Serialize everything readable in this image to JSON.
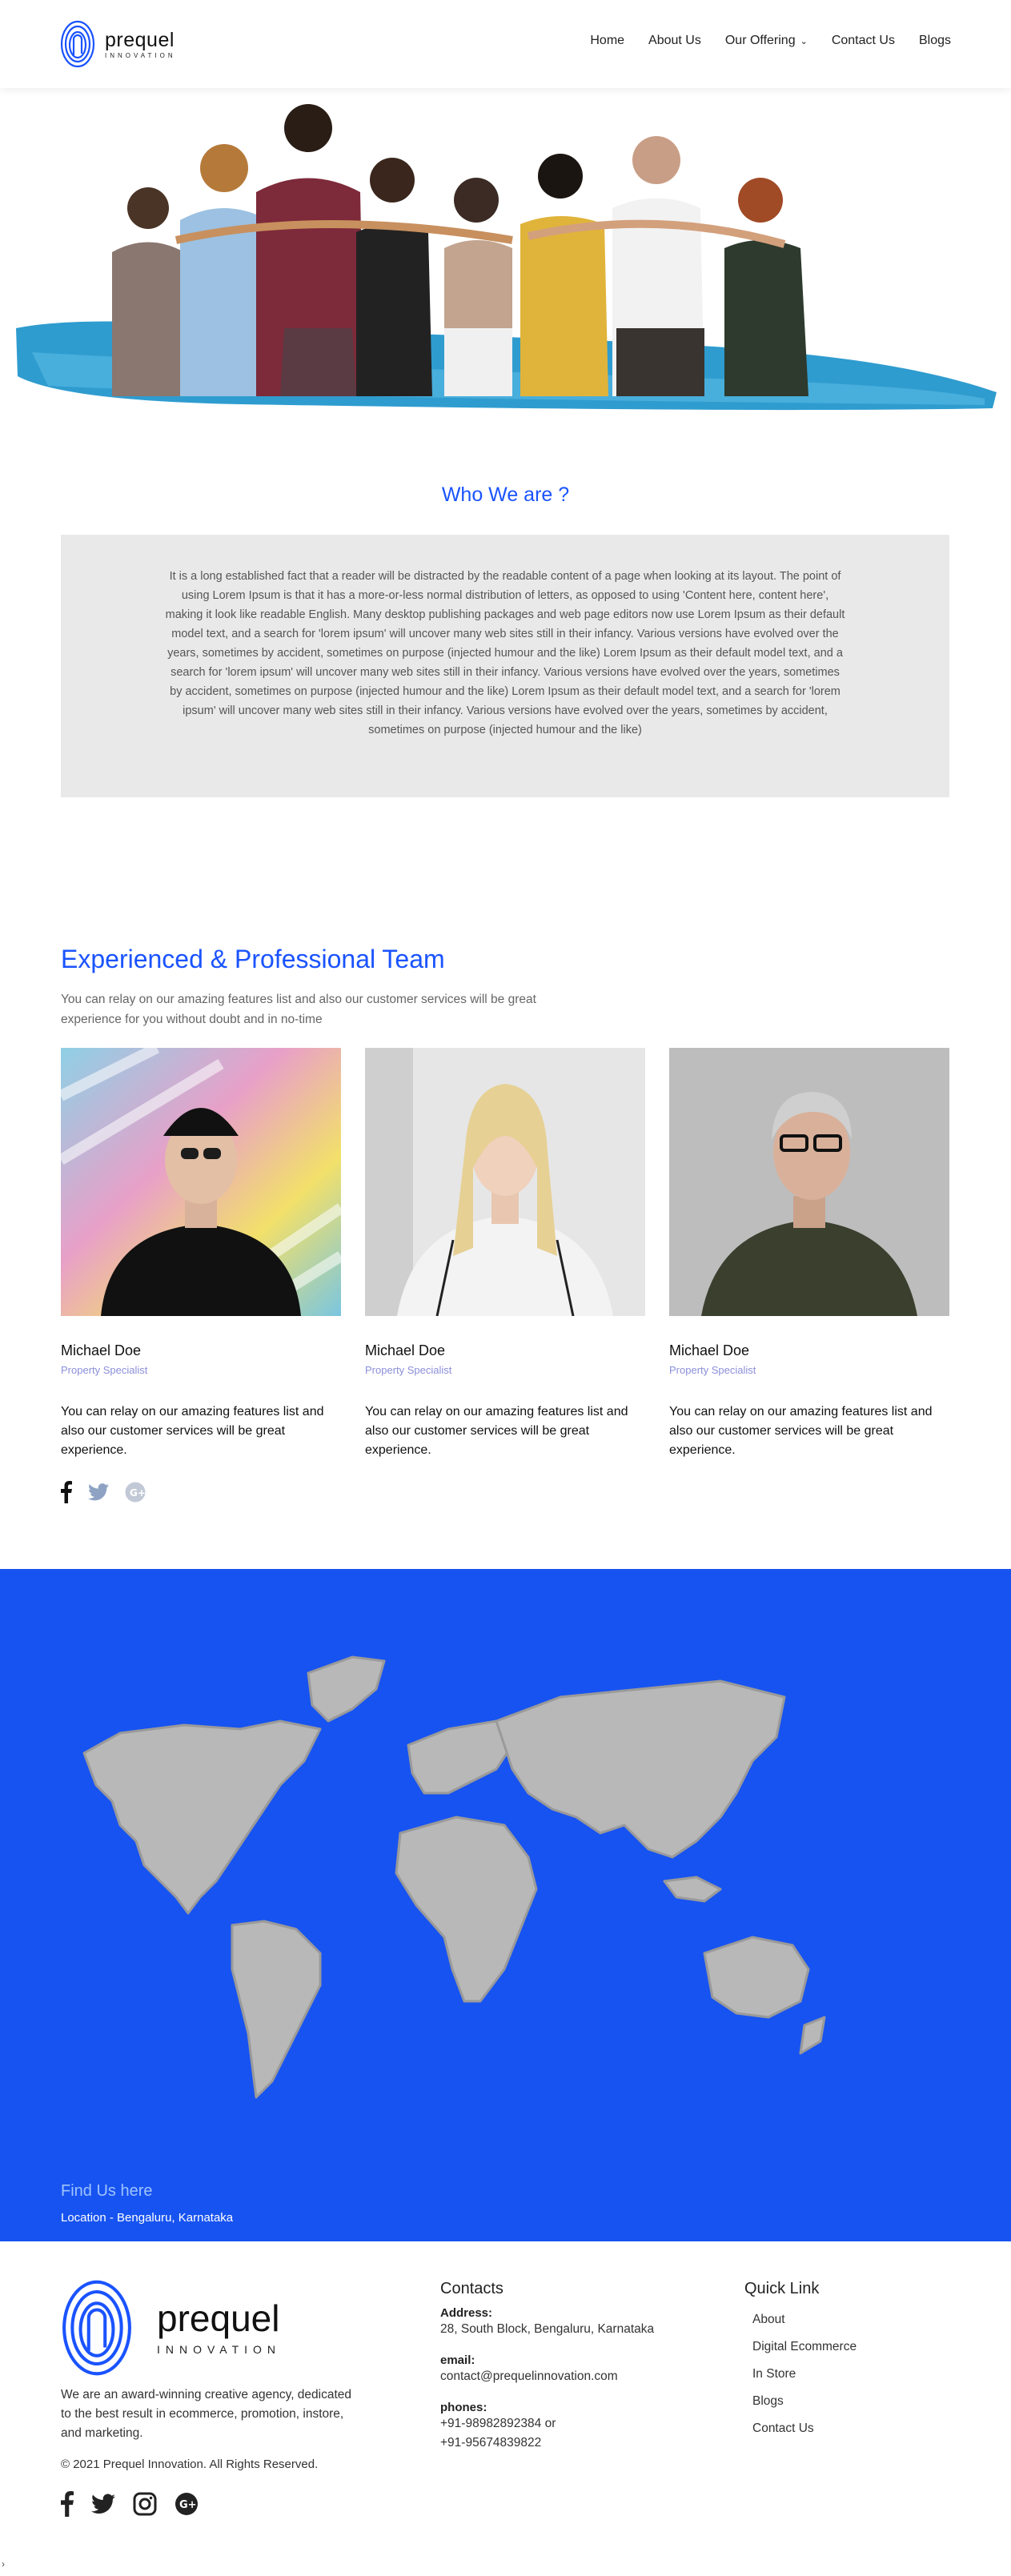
{
  "brand": {
    "name": "prequel",
    "tagline": "INNOVATION"
  },
  "nav": {
    "items": [
      {
        "label": "Home"
      },
      {
        "label": "About Us"
      },
      {
        "label": "Our Offering",
        "has_dropdown": true
      },
      {
        "label": "Contact Us"
      },
      {
        "label": "Blogs"
      }
    ]
  },
  "who": {
    "title": "Who We are ?",
    "body": "It is a long established fact that a reader will be distracted by the readable content of a page when looking at its layout. The point of using Lorem Ipsum is that it has a more-or-less normal distribution of letters, as opposed to using 'Content here, content here', making it look like readable English. Many desktop publishing packages and web page editors now use Lorem Ipsum as their default model text, and a search for 'lorem ipsum' will uncover many web sites still in their infancy. Various versions have evolved over the years, sometimes by accident, sometimes on purpose (injected humour and the like) Lorem Ipsum as their default model text, and a search for 'lorem ipsum' will uncover many web sites still in their infancy. Various versions have evolved over the years, sometimes by accident, sometimes on purpose (injected humour and the like) Lorem Ipsum as their default model text, and a search for 'lorem ipsum' will uncover many web sites still in their infancy. Various versions have evolved over the years, sometimes by accident, sometimes on purpose (injected humour and the like)"
  },
  "team": {
    "title": "Experienced & Professional Team",
    "subtitle": "You can relay on our amazing features list and also our customer services will be great experience for you without doubt and in no-time",
    "members": [
      {
        "name": "Michael Doe",
        "role": "Property Specialist",
        "bio": "You can relay on our amazing features list and also our customer services will be great experience."
      },
      {
        "name": "Michael Doe",
        "role": "Property Specialist",
        "bio": "You can relay on our amazing features list and also our customer services will be great experience."
      },
      {
        "name": "Michael Doe",
        "role": "Property Specialist",
        "bio": "You can relay on our amazing features list and also our customer services will be great experience."
      }
    ],
    "social_icons": [
      "facebook-icon",
      "twitter-icon",
      "google-plus-icon"
    ]
  },
  "find": {
    "title": "Find Us here",
    "location": "Location - Bengaluru, Karnataka"
  },
  "footer": {
    "about": "We are an award-winning creative agency, dedicated to the best result in ecommerce, promotion, instore, and marketing.",
    "copyright": "©  2021 Prequel Innovation. All Rights Reserved.",
    "social_icons": [
      "facebook-icon",
      "twitter-icon",
      "instagram-icon",
      "google-plus-icon"
    ],
    "contacts": {
      "title": "Contacts",
      "address_label": "Address:",
      "address": "28, South Block, Bengaluru, Karnataka",
      "email_label": "email:",
      "email": "contact@prequelinnovation.com",
      "phones_label": "phones:",
      "phone1": "+91-98982892384 or",
      "phone2": "+91-95674839822"
    },
    "quick_links": {
      "title": "Quick Link",
      "items": [
        "About",
        "Digital Ecommerce",
        "In Store",
        "Blogs",
        "Contact Us"
      ]
    }
  },
  "colors": {
    "accent": "#1a53ff",
    "map_bg": "#1753f0",
    "land": "#b8b8b8"
  }
}
